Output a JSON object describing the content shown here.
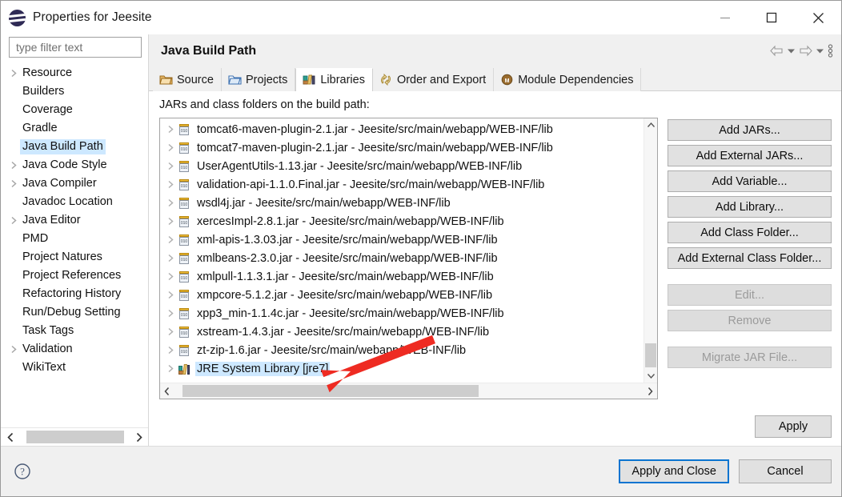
{
  "window": {
    "title": "Properties for Jeesite",
    "logo_icon": "eclipse-logo-icon",
    "minimize_label": "–",
    "maximize_label": "□",
    "close_label": "✕"
  },
  "filter": {
    "placeholder": "type filter text",
    "value": ""
  },
  "sidebar": {
    "items": [
      {
        "label": "Resource",
        "expandable": true,
        "selected": false
      },
      {
        "label": "Builders",
        "expandable": false,
        "selected": false
      },
      {
        "label": "Coverage",
        "expandable": false,
        "selected": false
      },
      {
        "label": "Gradle",
        "expandable": false,
        "selected": false
      },
      {
        "label": "Java Build Path",
        "expandable": false,
        "selected": true
      },
      {
        "label": "Java Code Style",
        "expandable": true,
        "selected": false
      },
      {
        "label": "Java Compiler",
        "expandable": true,
        "selected": false
      },
      {
        "label": "Javadoc Location",
        "expandable": false,
        "selected": false
      },
      {
        "label": "Java Editor",
        "expandable": true,
        "selected": false
      },
      {
        "label": "PMD",
        "expandable": false,
        "selected": false
      },
      {
        "label": "Project Natures",
        "expandable": false,
        "selected": false
      },
      {
        "label": "Project References",
        "expandable": false,
        "selected": false
      },
      {
        "label": "Refactoring History",
        "expandable": false,
        "selected": false
      },
      {
        "label": "Run/Debug Setting",
        "expandable": false,
        "selected": false
      },
      {
        "label": "Task Tags",
        "expandable": false,
        "selected": false
      },
      {
        "label": "Validation",
        "expandable": true,
        "selected": false
      },
      {
        "label": "WikiText",
        "expandable": false,
        "selected": false
      }
    ],
    "scroll_left_icon": "chevron-left-icon",
    "scroll_right_icon": "chevron-right-icon"
  },
  "page": {
    "title": "Java Build Path",
    "nav": {
      "back_icon": "back-arrow-icon",
      "back_menu_icon": "chevron-down-icon",
      "forward_icon": "forward-arrow-icon",
      "forward_menu_icon": "chevron-down-icon",
      "menu_icon": "vertical-dots-icon"
    }
  },
  "tabs": [
    {
      "label": "Source",
      "icon": "source-folder-icon",
      "active": false
    },
    {
      "label": "Projects",
      "icon": "projects-folder-icon",
      "active": false
    },
    {
      "label": "Libraries",
      "icon": "libraries-books-icon",
      "active": true
    },
    {
      "label": "Order and Export",
      "icon": "order-export-icon",
      "active": false
    },
    {
      "label": "Module Dependencies",
      "icon": "module-icon",
      "active": false
    }
  ],
  "content": {
    "label": "JARs and class folders on the build path:",
    "entries": [
      {
        "name": "tomcat6-maven-plugin-2.1.jar - Jeesite/src/main/webapp/WEB-INF/lib",
        "icon": "jar-icon",
        "selected": false
      },
      {
        "name": "tomcat7-maven-plugin-2.1.jar - Jeesite/src/main/webapp/WEB-INF/lib",
        "icon": "jar-icon",
        "selected": false
      },
      {
        "name": "UserAgentUtils-1.13.jar - Jeesite/src/main/webapp/WEB-INF/lib",
        "icon": "jar-icon",
        "selected": false
      },
      {
        "name": "validation-api-1.1.0.Final.jar - Jeesite/src/main/webapp/WEB-INF/lib",
        "icon": "jar-icon",
        "selected": false
      },
      {
        "name": "wsdl4j.jar - Jeesite/src/main/webapp/WEB-INF/lib",
        "icon": "jar-icon",
        "selected": false
      },
      {
        "name": "xercesImpl-2.8.1.jar - Jeesite/src/main/webapp/WEB-INF/lib",
        "icon": "jar-icon",
        "selected": false
      },
      {
        "name": "xml-apis-1.3.03.jar - Jeesite/src/main/webapp/WEB-INF/lib",
        "icon": "jar-icon",
        "selected": false
      },
      {
        "name": "xmlbeans-2.3.0.jar - Jeesite/src/main/webapp/WEB-INF/lib",
        "icon": "jar-icon",
        "selected": false
      },
      {
        "name": "xmlpull-1.1.3.1.jar - Jeesite/src/main/webapp/WEB-INF/lib",
        "icon": "jar-icon",
        "selected": false
      },
      {
        "name": "xmpcore-5.1.2.jar - Jeesite/src/main/webapp/WEB-INF/lib",
        "icon": "jar-icon",
        "selected": false
      },
      {
        "name": "xpp3_min-1.1.4c.jar - Jeesite/src/main/webapp/WEB-INF/lib",
        "icon": "jar-icon",
        "selected": false
      },
      {
        "name": "xstream-1.4.3.jar - Jeesite/src/main/webapp/WEB-INF/lib",
        "icon": "jar-icon",
        "selected": false
      },
      {
        "name": "zt-zip-1.6.jar - Jeesite/src/main/webapp/WEB-INF/lib",
        "icon": "jar-icon",
        "selected": false
      },
      {
        "name": "JRE System Library [jre7]",
        "icon": "library-icon",
        "selected": true
      }
    ]
  },
  "side_buttons": [
    {
      "label": "Add JARs...",
      "enabled": true
    },
    {
      "label": "Add External JARs...",
      "enabled": true
    },
    {
      "label": "Add Variable...",
      "enabled": true
    },
    {
      "label": "Add Library...",
      "enabled": true
    },
    {
      "label": "Add Class Folder...",
      "enabled": true
    },
    {
      "label": "Add External Class Folder...",
      "enabled": true
    },
    {
      "label": "Edit...",
      "enabled": false
    },
    {
      "label": "Remove",
      "enabled": false
    },
    {
      "label": "Migrate JAR File...",
      "enabled": false
    }
  ],
  "actions": {
    "apply": "Apply",
    "apply_and_close": "Apply and Close",
    "cancel": "Cancel",
    "help_icon": "help-question-icon"
  },
  "annotation": {
    "type": "arrow",
    "color": "#ee2b22",
    "points_to": "JRE System Library [jre7]"
  },
  "colors": {
    "selection_blue": "#cde8ff",
    "default_button_border": "#0a74d0",
    "annotation_red": "#ee2b22",
    "dialog_bg": "#f0f0f0"
  }
}
